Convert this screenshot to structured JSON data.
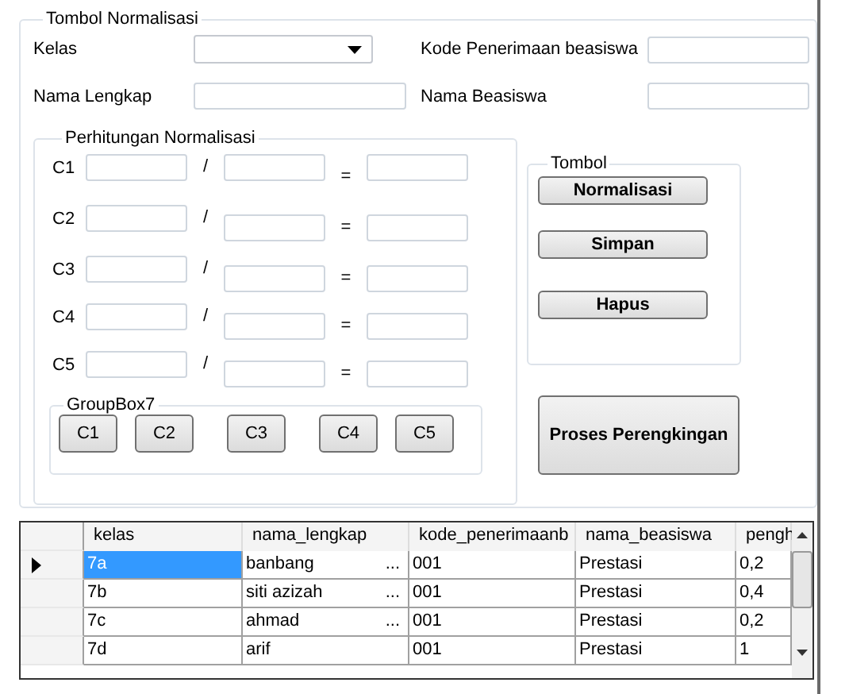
{
  "main_group": {
    "title": "Tombol Normalisasi",
    "fields": [
      {
        "label": "Kelas",
        "kind": "dropdown"
      },
      {
        "label": "Kode Penerimaan beasiswa",
        "kind": "text"
      },
      {
        "label": "Nama Lengkap",
        "kind": "text"
      },
      {
        "label": "Nama Beasiswa",
        "kind": "text"
      }
    ],
    "calc_group": {
      "title": "Perhitungan Normalisasi",
      "divide_sign": "/",
      "equals_sign": "=",
      "rows": [
        {
          "label": "C1"
        },
        {
          "label": "C2"
        },
        {
          "label": "C3"
        },
        {
          "label": "C4"
        },
        {
          "label": "C5"
        }
      ],
      "sub_group": {
        "title": "GroupBox7",
        "buttons": [
          "C1",
          "C2",
          "C3",
          "C4",
          "C5"
        ]
      }
    },
    "button_group": {
      "title": "Tombol",
      "buttons": [
        "Normalisasi",
        "Simpan",
        "Hapus"
      ]
    },
    "rank_button": "Proses Perengkingan"
  },
  "table": {
    "columns": [
      "kelas",
      "nama_lengkap",
      "kode_penerimaanb",
      "nama_beasiswa",
      "pengh"
    ],
    "rows": [
      {
        "selected": true,
        "cells": [
          "7a",
          "banbang",
          "001",
          "Prestasi",
          "0,2"
        ],
        "more": "..."
      },
      {
        "selected": false,
        "cells": [
          "7b",
          "siti azizah",
          "001",
          "Prestasi",
          "0,4"
        ],
        "more": "..."
      },
      {
        "selected": false,
        "cells": [
          "7c",
          "ahmad",
          "001",
          "Prestasi",
          "0,2"
        ],
        "more": "..."
      },
      {
        "selected": false,
        "cells": [
          "7d",
          "arif",
          "001",
          "Prestasi",
          "1"
        ]
      }
    ]
  }
}
